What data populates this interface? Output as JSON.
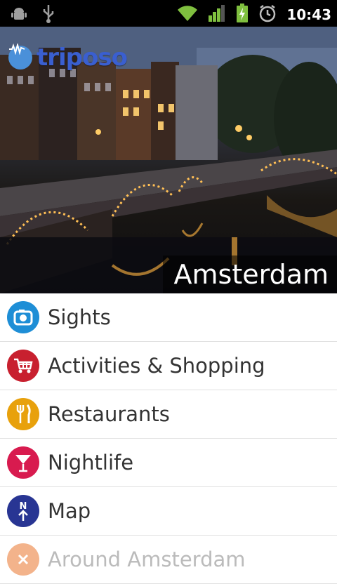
{
  "status_bar": {
    "time": "10:43",
    "icons": [
      "android-debug-icon",
      "usb-icon",
      "wifi-icon",
      "signal-icon",
      "battery-charging-icon",
      "alarm-icon"
    ]
  },
  "hero": {
    "logo_text": "triposo",
    "city": "Amsterdam"
  },
  "menu": {
    "items": [
      {
        "label": "Sights",
        "icon": "camera-icon",
        "color": "#1e8ed6"
      },
      {
        "label": "Activities & Shopping",
        "icon": "shopping-cart-icon",
        "color": "#c8202f"
      },
      {
        "label": "Restaurants",
        "icon": "fork-knife-icon",
        "color": "#e8a10c"
      },
      {
        "label": "Nightlife",
        "icon": "cocktail-icon",
        "color": "#d81b4f"
      },
      {
        "label": "Map",
        "icon": "north-arrow-icon",
        "color": "#283593"
      },
      {
        "label": "Around Amsterdam",
        "icon": "around-icon",
        "color": "#e86a1a"
      }
    ]
  }
}
